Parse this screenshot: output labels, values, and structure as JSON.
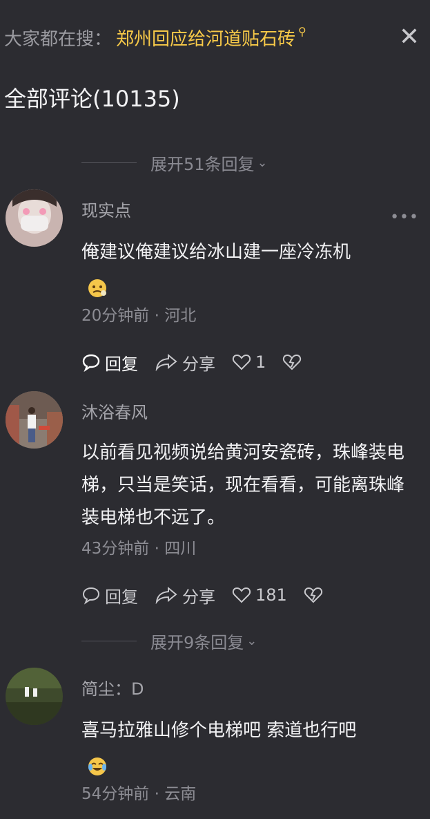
{
  "header": {
    "search_prefix": "大家都在搜：",
    "search_term": "郑州回应给河道贴石砖",
    "close_icon": "close-icon"
  },
  "comments_title": "全部评论(10135)",
  "expand_top": "展开51条回复",
  "expand_mid": "展开9条回复",
  "comments": [
    {
      "user": "现实点",
      "text": "俺建议俺建议给冰山建一座冷冻机",
      "emoji": "🥶",
      "time": "20分钟前 · 河北",
      "reply": "回复",
      "share": "分享",
      "likes": "1"
    },
    {
      "user": "沐浴春风",
      "text": "以前看见视频说给黄河安瓷砖，珠峰装电梯，只当是笑话，现在看看，可能离珠峰装电梯也不远了。",
      "time": "43分钟前 · 四川",
      "reply": "回复",
      "share": "分享",
      "likes": "181"
    },
    {
      "user": "简尘：D",
      "text": "喜马拉雅山修个电梯吧 索道也行吧",
      "emoji": "😂",
      "time": "54分钟前 · 云南"
    }
  ],
  "colors": {
    "background": "#2c2c31",
    "accent_yellow": "#f7c948"
  }
}
